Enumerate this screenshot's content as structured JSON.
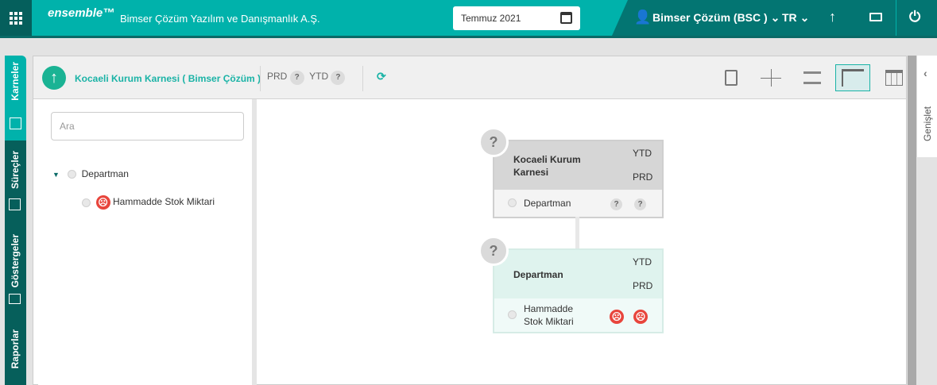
{
  "topbar": {
    "logo": "ensemble™",
    "company": "Bimser Çözüm Yazılım ve Danışmanlık A.Ş.",
    "period": "Temmuz 2021",
    "user": "Bimser Çözüm (BSC )",
    "language": "TR"
  },
  "sidebar": {
    "tabs": [
      {
        "label": "Karneler"
      },
      {
        "label": "Süreçler"
      },
      {
        "label": "Göstergeler"
      },
      {
        "label": "Raporlar"
      }
    ]
  },
  "header": {
    "title": "Kocaeli Kurum Karnesi ( Bimser Çözüm )",
    "prd": "PRD",
    "ytd": "YTD",
    "q": "?"
  },
  "right_tab": {
    "label": "Genişlet"
  },
  "tree": {
    "search_placeholder": "Ara",
    "root": "Departman",
    "child": "Hammadde Stok Miktari"
  },
  "cards": [
    {
      "title": "Kocaeli Kurum Karnesi",
      "ytd": "YTD",
      "prd": "PRD",
      "q": "?",
      "row": "Departman",
      "status": "unknown"
    },
    {
      "title": "Departman",
      "ytd": "YTD",
      "prd": "PRD",
      "q": "?",
      "row": "Hammadde Stok Miktari",
      "status": "bad"
    }
  ],
  "colors": {
    "teal": "#00b2ab",
    "dark_teal": "#037572",
    "bad": "#e8453c"
  }
}
